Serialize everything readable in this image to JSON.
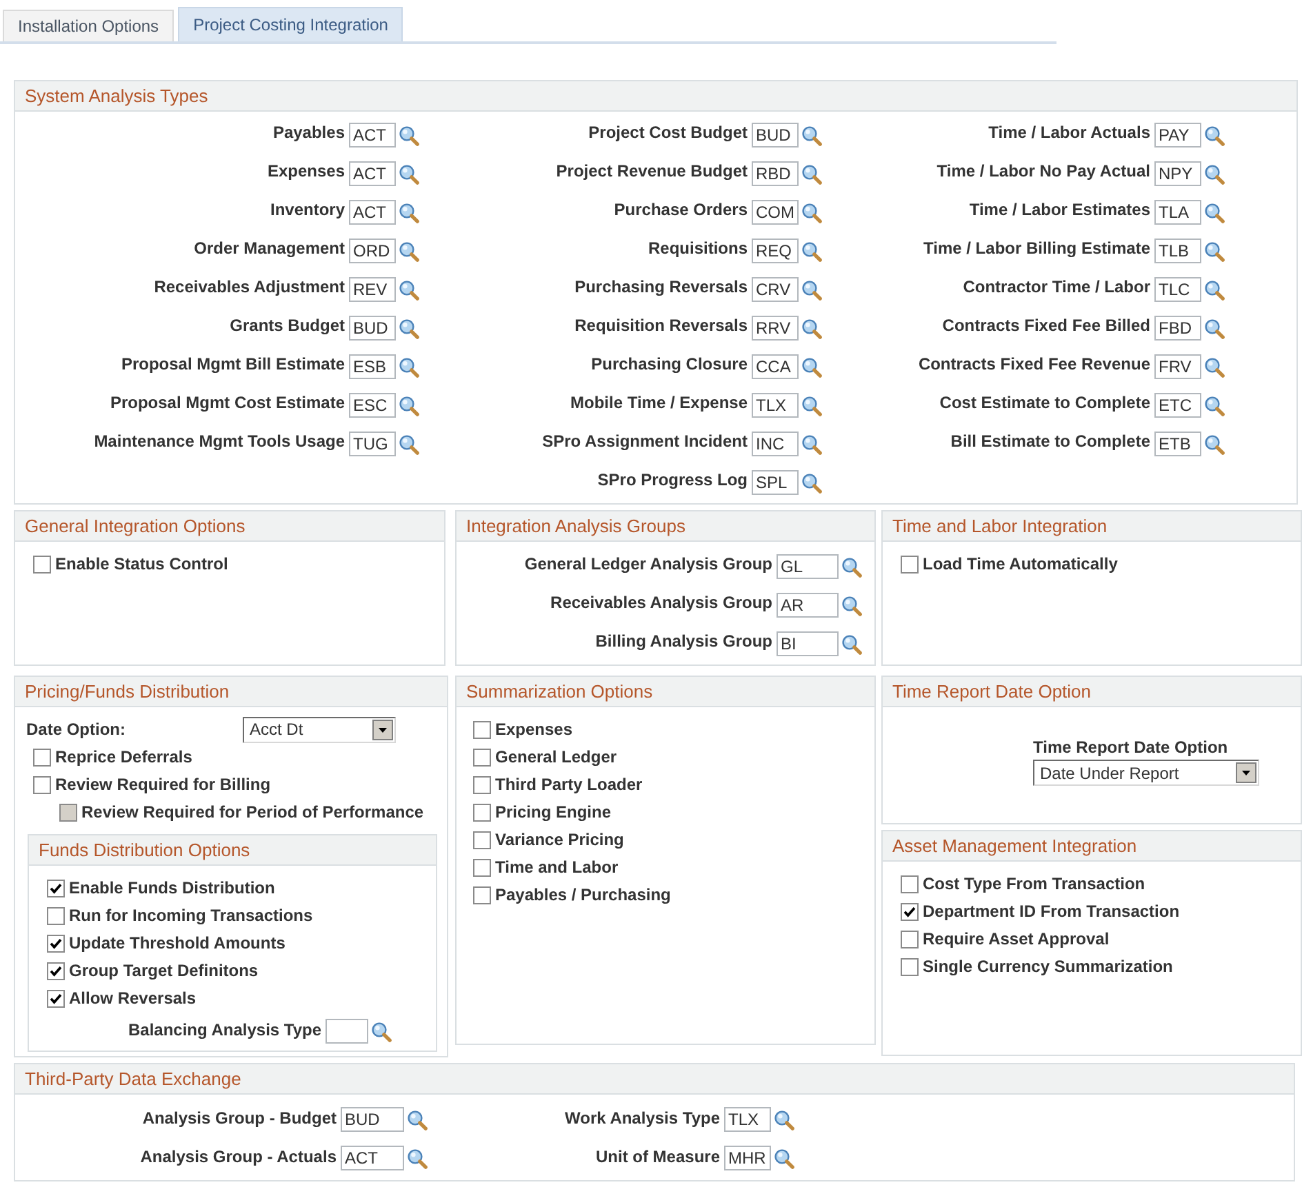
{
  "tabs": [
    {
      "label": "Installation Options",
      "selected": false
    },
    {
      "label": "Project Costing Integration",
      "selected": true
    }
  ],
  "system_analysis_types": {
    "title": "System Analysis Types",
    "columns": [
      [
        {
          "label": "Payables",
          "value": "ACT"
        },
        {
          "label": "Expenses",
          "value": "ACT"
        },
        {
          "label": "Inventory",
          "value": "ACT"
        },
        {
          "label": "Order Management",
          "value": "ORD"
        },
        {
          "label": "Receivables Adjustment",
          "value": "REV"
        },
        {
          "label": "Grants Budget",
          "value": "BUD"
        },
        {
          "label": "Proposal Mgmt Bill Estimate",
          "value": "ESB"
        },
        {
          "label": "Proposal Mgmt Cost Estimate",
          "value": "ESC"
        },
        {
          "label": "Maintenance Mgmt Tools Usage",
          "value": "TUG"
        }
      ],
      [
        {
          "label": "Project Cost Budget",
          "value": "BUD"
        },
        {
          "label": "Project Revenue Budget",
          "value": "RBD"
        },
        {
          "label": "Purchase Orders",
          "value": "COM"
        },
        {
          "label": "Requisitions",
          "value": "REQ"
        },
        {
          "label": "Purchasing Reversals",
          "value": "CRV"
        },
        {
          "label": "Requisition Reversals",
          "value": "RRV"
        },
        {
          "label": "Purchasing Closure",
          "value": "CCA"
        },
        {
          "label": "Mobile Time / Expense",
          "value": "TLX"
        },
        {
          "label": "SPro Assignment Incident",
          "value": "INC"
        },
        {
          "label": "SPro Progress Log",
          "value": "SPL"
        }
      ],
      [
        {
          "label": "Time / Labor Actuals",
          "value": "PAY"
        },
        {
          "label": "Time / Labor No Pay Actual",
          "value": "NPY"
        },
        {
          "label": "Time / Labor Estimates",
          "value": "TLA"
        },
        {
          "label": "Time / Labor Billing Estimate",
          "value": "TLB"
        },
        {
          "label": "Contractor Time / Labor",
          "value": "TLC"
        },
        {
          "label": "Contracts Fixed Fee Billed",
          "value": "FBD"
        },
        {
          "label": "Contracts Fixed Fee Revenue",
          "value": "FRV"
        },
        {
          "label": "Cost Estimate to Complete",
          "value": "ETC"
        },
        {
          "label": "Bill Estimate to Complete",
          "value": "ETB"
        }
      ]
    ]
  },
  "general_integration_options": {
    "title": "General Integration Options",
    "options": [
      {
        "label": "Enable Status Control",
        "checked": false
      }
    ]
  },
  "integration_analysis_groups": {
    "title": "Integration Analysis Groups",
    "fields": [
      {
        "label": "General Ledger Analysis Group",
        "value": "GL"
      },
      {
        "label": "Receivables Analysis Group",
        "value": "AR"
      },
      {
        "label": "Billing Analysis Group",
        "value": "BI"
      }
    ]
  },
  "time_and_labor_integration": {
    "title": "Time and Labor Integration",
    "options": [
      {
        "label": "Load Time Automatically",
        "checked": false
      }
    ]
  },
  "pricing_funds_distribution": {
    "title": "Pricing/Funds Distribution",
    "date_option": {
      "label": "Date Option:",
      "value": "Acct Dt"
    },
    "options": [
      {
        "label": "Reprice Deferrals",
        "checked": false,
        "disabled": false
      },
      {
        "label": "Review Required for Billing",
        "checked": false,
        "disabled": false,
        "children": [
          {
            "label": "Review Required for Period of Performance",
            "checked": false,
            "disabled": true
          }
        ]
      }
    ],
    "funds_distribution_options": {
      "title": "Funds Distribution Options",
      "options": [
        {
          "label": "Enable Funds Distribution",
          "checked": true
        },
        {
          "label": "Run for Incoming Transactions",
          "checked": false
        },
        {
          "label": "Update Threshold Amounts",
          "checked": true
        },
        {
          "label": "Group Target Definitons",
          "checked": true
        },
        {
          "label": "Allow Reversals",
          "checked": true
        }
      ],
      "balancing_analysis_type": {
        "label": "Balancing Analysis Type"
      }
    }
  },
  "summarization_options": {
    "title": "Summarization Options",
    "options": [
      {
        "label": "Expenses",
        "checked": false
      },
      {
        "label": "General Ledger",
        "checked": false
      },
      {
        "label": "Third Party Loader",
        "checked": false
      },
      {
        "label": "Pricing Engine",
        "checked": false
      },
      {
        "label": "Variance Pricing",
        "checked": false
      },
      {
        "label": "Time and Labor",
        "checked": false
      },
      {
        "label": "Payables / Purchasing",
        "checked": false
      }
    ]
  },
  "time_report_date_option": {
    "title": "Time Report Date Option",
    "field": {
      "label": "Time Report Date Option",
      "value": "Date Under Report"
    }
  },
  "asset_management_integration": {
    "title": "Asset Management Integration",
    "options": [
      {
        "label": "Cost Type From Transaction",
        "checked": false
      },
      {
        "label": "Department ID From Transaction",
        "checked": true
      },
      {
        "label": "Require Asset Approval",
        "checked": false
      },
      {
        "label": "Single Currency Summarization",
        "checked": false
      }
    ]
  },
  "third_party_data_exchange": {
    "title": "Third-Party Data Exchange",
    "columns": [
      [
        {
          "label": "Analysis Group - Budget",
          "value": "BUD"
        },
        {
          "label": "Analysis Group - Actuals",
          "value": "ACT"
        }
      ],
      [
        {
          "label": "Work Analysis Type",
          "value": "TLX"
        },
        {
          "label": "Unit of Measure",
          "value": "MHR"
        }
      ]
    ]
  }
}
